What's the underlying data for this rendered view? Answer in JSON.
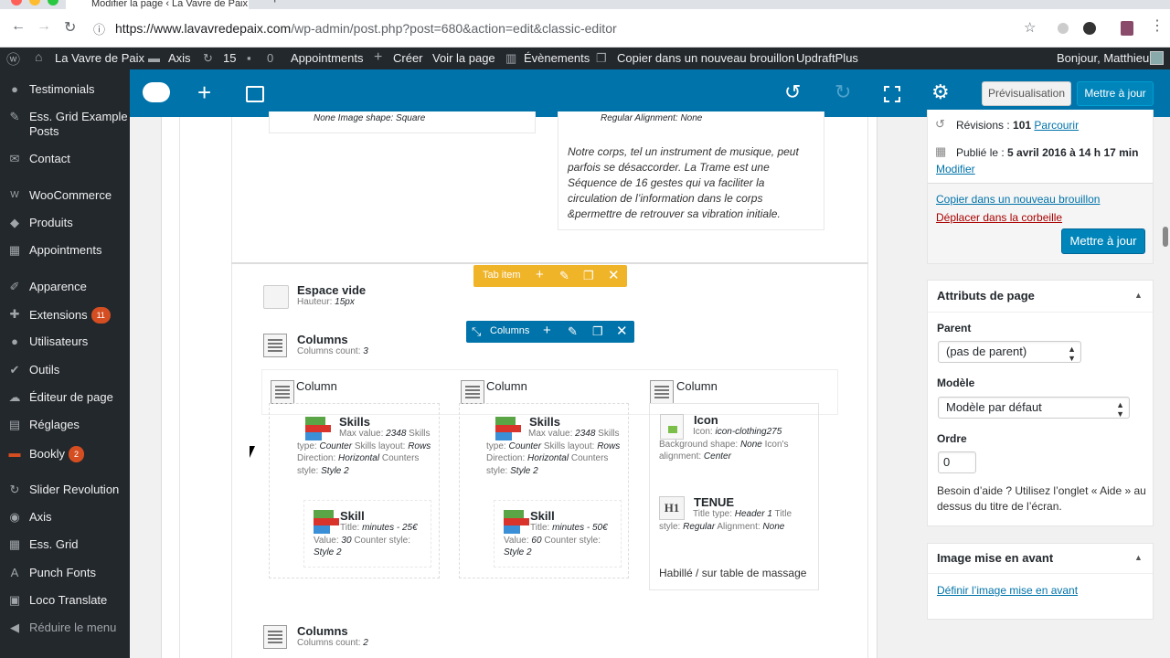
{
  "browser": {
    "tab_title": "Modifier la page ‹ La Vavre de Paix",
    "url_host": "https://www.lavavredepaix.com",
    "url_path": "/wp-admin/post.php?post=680&action=edit&classic-editor"
  },
  "adminbar": {
    "site": "La Vavre de Paix",
    "axis": "Axis",
    "updates": "15",
    "comments": "0",
    "appointments": "Appointments",
    "create": "Créer",
    "view_page": "Voir la page",
    "events": "Évènements",
    "copy_draft": "Copier dans un nouveau brouillon",
    "updraft": "UpdraftPlus",
    "greeting": "Bonjour, Matthieu"
  },
  "sidebar": {
    "items": [
      {
        "label": "Testimonials",
        "icon": "testimonial-icon"
      },
      {
        "label": "Ess. Grid Example Posts",
        "icon": "pin-icon"
      },
      {
        "label": "Contact",
        "icon": "mail-icon"
      },
      {
        "label": "WooCommerce",
        "icon": "woo-icon"
      },
      {
        "label": "Produits",
        "icon": "box-icon"
      },
      {
        "label": "Appointments",
        "icon": "calendar-icon"
      },
      {
        "label": "Apparence",
        "icon": "brush-icon"
      },
      {
        "label": "Extensions",
        "icon": "plug-icon",
        "badge": "11"
      },
      {
        "label": "Utilisateurs",
        "icon": "user-icon"
      },
      {
        "label": "Outils",
        "icon": "wrench-icon"
      },
      {
        "label": "Éditeur de page",
        "icon": "cloud-icon"
      },
      {
        "label": "Réglages",
        "icon": "settings-icon"
      },
      {
        "label": "Bookly",
        "icon": "bookly-icon",
        "badge": "2"
      },
      {
        "label": "Slider Revolution",
        "icon": "refresh-icon"
      },
      {
        "label": "Axis",
        "icon": "axis-icon"
      },
      {
        "label": "Ess. Grid",
        "icon": "grid-icon"
      },
      {
        "label": "Punch Fonts",
        "icon": "font-icon"
      },
      {
        "label": "Loco Translate",
        "icon": "translate-icon"
      },
      {
        "label": "Réduire le menu",
        "icon": "collapse-icon"
      }
    ]
  },
  "toolbar": {
    "preview": "Prévisualisation",
    "update": "Mettre à jour"
  },
  "content": {
    "top_left_desc": "None  Image shape: Square",
    "top_right_desc": "Regular  Alignment: None",
    "quote": "Notre corps, tel un instrument de musique, peut parfois se désaccorder. La Trame est une Séquence de 16 gestes  qui va faciliter la circulation de l’information dans le corps &permettre de retrouver sa vibration initiale.",
    "tab_item_label": "Tab item",
    "columns_ctl_label": "Columns",
    "spacer": {
      "title": "Espace vide",
      "desc_label": "Hauteur:",
      "desc_value": "15px"
    },
    "columns1": {
      "title": "Columns",
      "desc_label": "Columns count:",
      "desc_value": "3"
    },
    "column_label": "Column",
    "skills": {
      "title": "Skills",
      "maxvalue_label": "Max value:",
      "maxvalue": "2348",
      "type_label": "Skills type:",
      "type": "Counter",
      "layout_label": "Skills layout:",
      "layout": "Rows",
      "direction_label": "Direction:",
      "direction": "Horizontal",
      "cstyle_label": "Counters style:",
      "cstyle": "Style 2"
    },
    "skill1": {
      "title": "Skill",
      "title_label": "Title:",
      "title_val": "minutes - 25€",
      "value_label": "Value:",
      "value": "30",
      "cstyle_label": "Counter style:",
      "cstyle": "Style 2"
    },
    "skill2": {
      "title": "Skill",
      "title_label": "Title:",
      "title_val": "minutes - 50€",
      "value_label": "Value:",
      "value": "60",
      "cstyle_label": "Counter style:",
      "cstyle": "Style 2"
    },
    "icon_el": {
      "title": "Icon",
      "icon_label": "Icon:",
      "icon_val": "icon-clothing275",
      "bg_label": "Background shape:",
      "bg_val": "None",
      "align_label": "Icon's alignment:",
      "align_val": "Center"
    },
    "heading_el": {
      "title": "TENUE",
      "badge": "H1",
      "type_label": "Title type:",
      "type_val": "Header 1",
      "style_label": "Title style:",
      "style_val": "Regular",
      "align_label": "Alignment:",
      "align_val": "None"
    },
    "text_el": "Habillé / sur table de massage",
    "columns2": {
      "title": "Columns",
      "desc_label": "Columns count:",
      "desc_value": "2"
    }
  },
  "publish": {
    "revisions_label": "Révisions :",
    "revisions_count": "101",
    "revisions_link": "Parcourir",
    "published_label": "Publié le :",
    "published_date": "5 avril 2016 à 14 h 17 min",
    "modify_link": "Modifier",
    "copy_link": "Copier dans un nouveau brouillon",
    "trash_link": "Déplacer dans la corbeille",
    "update": "Mettre à jour"
  },
  "attributes": {
    "title": "Attributs de page",
    "parent_label": "Parent",
    "parent_value": "(pas de parent)",
    "template_label": "Modèle",
    "template_value": "Modèle par défaut",
    "order_label": "Ordre",
    "order_value": "0",
    "help": "Besoin d’aide ? Utilisez l’onglet « Aide » au dessus du titre de l’écran."
  },
  "featured": {
    "title": "Image mise en avant",
    "link": "Définir l’image mise en avant"
  },
  "colors": {
    "wp_dark": "#23282d",
    "toolbar_blue": "#0073aa",
    "tab_item_orange": "#f0b429",
    "columns_ctl_blue": "#0073aa"
  }
}
